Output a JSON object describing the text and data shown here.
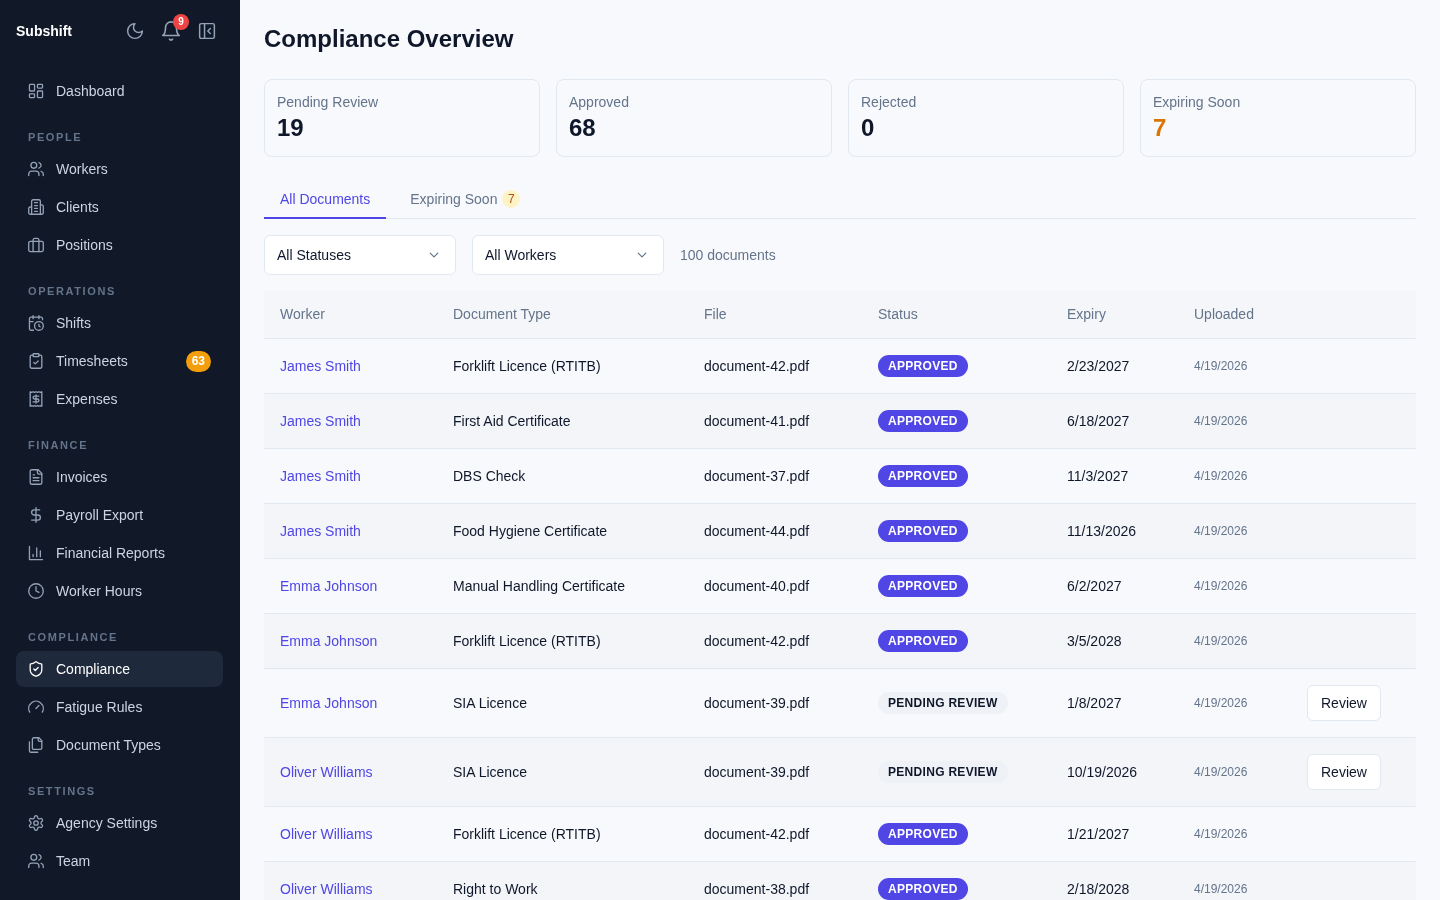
{
  "sidebar": {
    "brand": "Subshift",
    "notification_count": "9",
    "groups": [
      {
        "items": [
          {
            "label": "Dashboard",
            "selected": false
          }
        ]
      },
      {
        "heading": "PEOPLE",
        "items": [
          {
            "label": "Workers",
            "selected": false
          },
          {
            "label": "Clients",
            "selected": false
          },
          {
            "label": "Positions",
            "selected": false
          }
        ]
      },
      {
        "heading": "OPERATIONS",
        "items": [
          {
            "label": "Shifts",
            "selected": false
          },
          {
            "label": "Timesheets",
            "selected": false,
            "badge": "63"
          },
          {
            "label": "Expenses",
            "selected": false
          }
        ]
      },
      {
        "heading": "FINANCE",
        "items": [
          {
            "label": "Invoices",
            "selected": false
          },
          {
            "label": "Payroll Export",
            "selected": false
          },
          {
            "label": "Financial Reports",
            "selected": false
          },
          {
            "label": "Worker Hours",
            "selected": false
          }
        ]
      },
      {
        "heading": "COMPLIANCE",
        "items": [
          {
            "label": "Compliance",
            "selected": true
          },
          {
            "label": "Fatigue Rules",
            "selected": false
          },
          {
            "label": "Document Types",
            "selected": false
          }
        ]
      },
      {
        "heading": "SETTINGS",
        "items": [
          {
            "label": "Agency Settings",
            "selected": false
          },
          {
            "label": "Team",
            "selected": false
          }
        ]
      }
    ]
  },
  "page": {
    "title": "Compliance Overview"
  },
  "stats": [
    {
      "label": "Pending Review",
      "value": "19",
      "color": "#0f172a"
    },
    {
      "label": "Approved",
      "value": "68",
      "color": "#0f172a"
    },
    {
      "label": "Rejected",
      "value": "0",
      "color": "#0f172a"
    },
    {
      "label": "Expiring Soon",
      "value": "7",
      "color": "#d97706"
    }
  ],
  "tabs": [
    {
      "label": "All Documents",
      "selected": true
    },
    {
      "label": "Expiring Soon",
      "selected": false,
      "badge": "7"
    }
  ],
  "filters": {
    "dropdowns": [
      {
        "value": "All Statuses"
      },
      {
        "value": "All Workers"
      }
    ],
    "result_count": "100 documents"
  },
  "table": {
    "columns": [
      "Worker",
      "Document Type",
      "File",
      "Status",
      "Expiry",
      "Uploaded"
    ],
    "rows": [
      {
        "worker": "James Smith",
        "document_type": "Forklift Licence (RTITB)",
        "file": "document-42.pdf",
        "status": {
          "label": "APPROVED",
          "kind": "approved"
        },
        "expiry": "2/23/2027",
        "uploaded": "4/19/2026"
      },
      {
        "worker": "James Smith",
        "document_type": "First Aid Certificate",
        "file": "document-41.pdf",
        "status": {
          "label": "APPROVED",
          "kind": "approved"
        },
        "expiry": "6/18/2027",
        "uploaded": "4/19/2026"
      },
      {
        "worker": "James Smith",
        "document_type": "DBS Check",
        "file": "document-37.pdf",
        "status": {
          "label": "APPROVED",
          "kind": "approved"
        },
        "expiry": "11/3/2027",
        "uploaded": "4/19/2026"
      },
      {
        "worker": "James Smith",
        "document_type": "Food Hygiene Certificate",
        "file": "document-44.pdf",
        "status": {
          "label": "APPROVED",
          "kind": "approved"
        },
        "expiry": "11/13/2026",
        "uploaded": "4/19/2026"
      },
      {
        "worker": "Emma Johnson",
        "document_type": "Manual Handling Certificate",
        "file": "document-40.pdf",
        "status": {
          "label": "APPROVED",
          "kind": "approved"
        },
        "expiry": "6/2/2027",
        "uploaded": "4/19/2026"
      },
      {
        "worker": "Emma Johnson",
        "document_type": "Forklift Licence (RTITB)",
        "file": "document-42.pdf",
        "status": {
          "label": "APPROVED",
          "kind": "approved"
        },
        "expiry": "3/5/2028",
        "uploaded": "4/19/2026"
      },
      {
        "worker": "Emma Johnson",
        "document_type": "SIA Licence",
        "file": "document-39.pdf",
        "status": {
          "label": "PENDING REVIEW",
          "kind": "pending"
        },
        "expiry": "1/8/2027",
        "uploaded": "4/19/2026",
        "action": "Review"
      },
      {
        "worker": "Oliver Williams",
        "document_type": "SIA Licence",
        "file": "document-39.pdf",
        "status": {
          "label": "PENDING REVIEW",
          "kind": "pending"
        },
        "expiry": "10/19/2026",
        "uploaded": "4/19/2026",
        "action": "Review"
      },
      {
        "worker": "Oliver Williams",
        "document_type": "Forklift Licence (RTITB)",
        "file": "document-42.pdf",
        "status": {
          "label": "APPROVED",
          "kind": "approved"
        },
        "expiry": "1/21/2027",
        "uploaded": "4/19/2026"
      },
      {
        "worker": "Oliver Williams",
        "document_type": "Right to Work",
        "file": "document-38.pdf",
        "status": {
          "label": "APPROVED",
          "kind": "approved"
        },
        "expiry": "2/18/2028",
        "uploaded": "4/19/2026"
      }
    ]
  }
}
